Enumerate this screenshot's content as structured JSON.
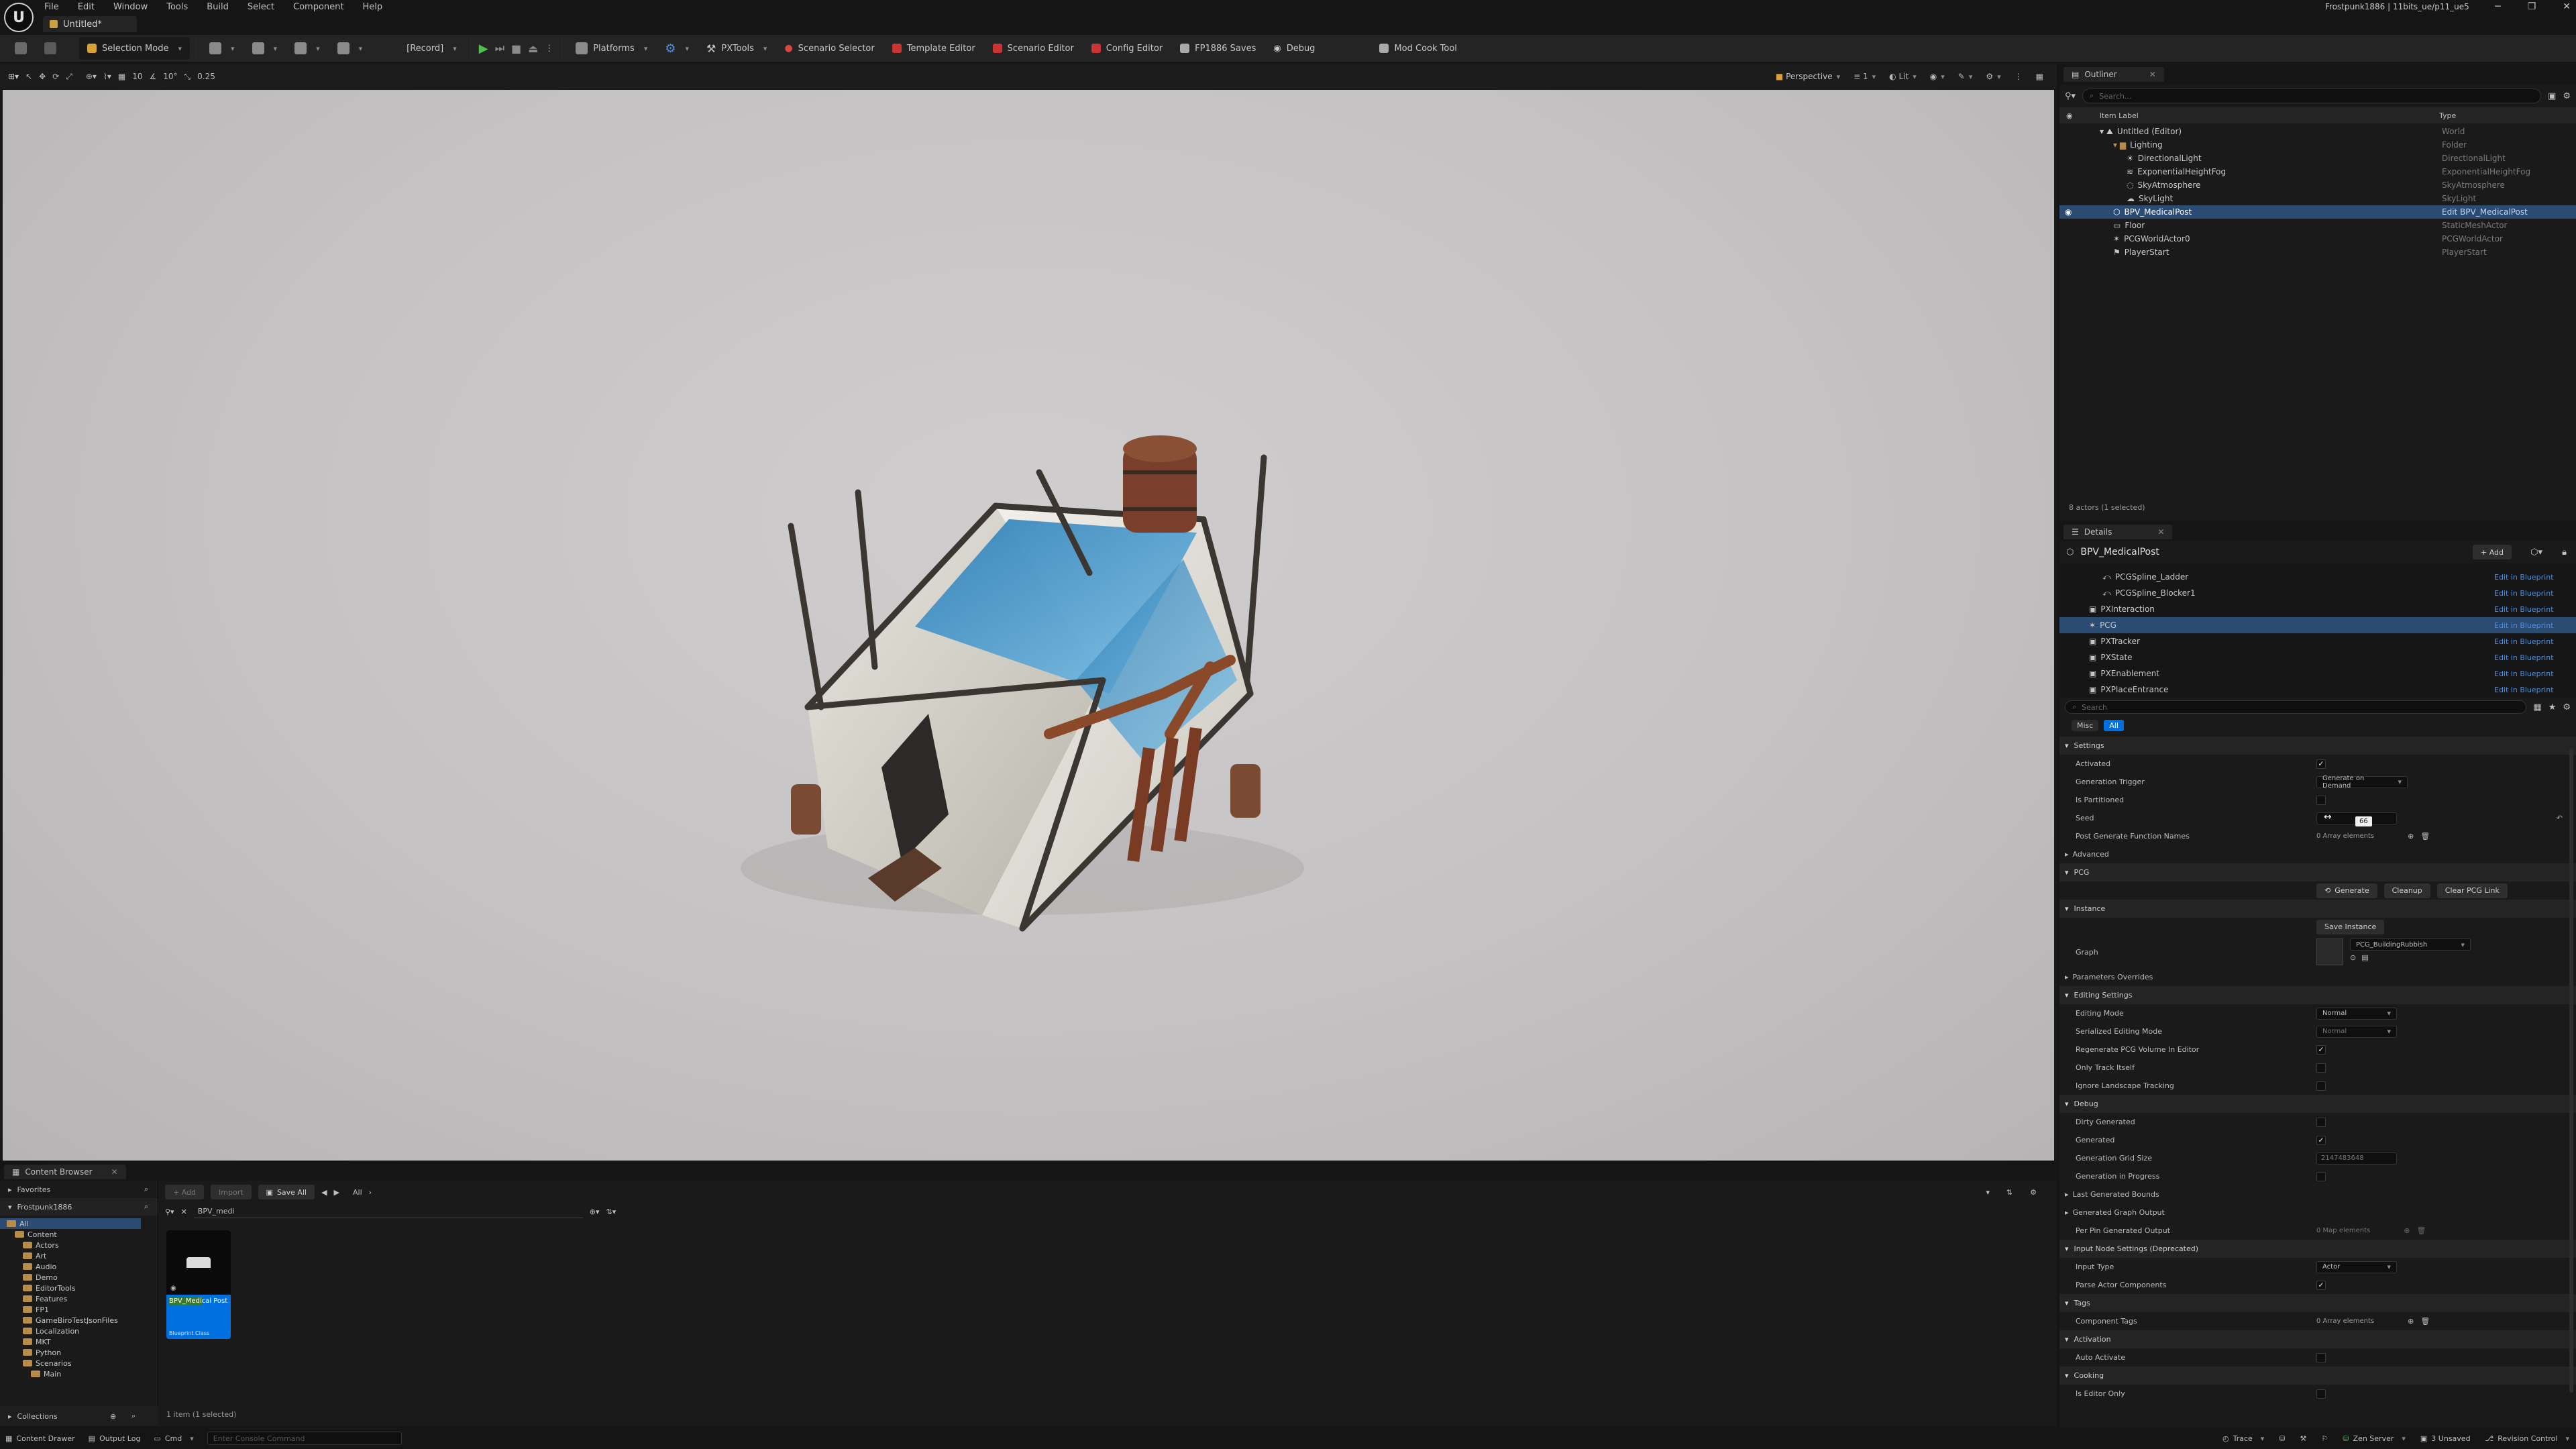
{
  "menubar": {
    "items": [
      "File",
      "Edit",
      "Window",
      "Tools",
      "Build",
      "Select",
      "Component",
      "Help"
    ],
    "project_title": "Frostpunk1886 | 11bits_ue/p11_ue5"
  },
  "tab": {
    "label": "Untitled*"
  },
  "toolbar": {
    "selection_mode": "Selection Mode",
    "record": "[Record]",
    "platforms": "Platforms",
    "pxtools": "PXTools",
    "scenario_selector": "Scenario Selector",
    "template_editor": "Template Editor",
    "scenario_editor": "Scenario Editor",
    "config_editor": "Config Editor",
    "fp1886_saves": "FP1886 Saves",
    "debug": "Debug",
    "mod_cook_tool": "Mod Cook Tool"
  },
  "viewport": {
    "perspective": "Perspective",
    "lit": "Lit",
    "snap_grid": "10",
    "snap_rotation": "10°",
    "snap_scale": "0.25",
    "camera_speed": "1"
  },
  "outliner": {
    "tab": "Outliner",
    "search_placeholder": "Search...",
    "col_label": "Item Label",
    "col_type": "Type",
    "rows": [
      {
        "label": "Untitled (Editor)",
        "type": "World"
      },
      {
        "label": "Lighting",
        "type": "Folder"
      },
      {
        "label": "DirectionalLight",
        "type": "DirectionalLight"
      },
      {
        "label": "ExponentialHeightFog",
        "type": "ExponentialHeightFog"
      },
      {
        "label": "SkyAtmosphere",
        "type": "SkyAtmosphere"
      },
      {
        "label": "SkyLight",
        "type": "SkyLight"
      },
      {
        "label": "BPV_MedicalPost",
        "type": "Edit BPV_MedicalPost"
      },
      {
        "label": "Floor",
        "type": "StaticMeshActor"
      },
      {
        "label": "PCGWorldActor0",
        "type": "PCGWorldActor"
      },
      {
        "label": "PlayerStart",
        "type": "PlayerStart"
      }
    ],
    "status": "8 actors (1 selected)"
  },
  "details": {
    "tab": "Details",
    "actor_name": "BPV_MedicalPost",
    "add_label": "+ Add",
    "components": [
      {
        "label": "PCGSpline_Ladder",
        "link": "Edit in Blueprint"
      },
      {
        "label": "PCGSpline_Blocker1",
        "link": "Edit in Blueprint"
      },
      {
        "label": "PXInteraction",
        "link": "Edit in Blueprint"
      },
      {
        "label": "PCG",
        "link": "Edit in Blueprint"
      },
      {
        "label": "PXTracker",
        "link": "Edit in Blueprint"
      },
      {
        "label": "PXState",
        "link": "Edit in Blueprint"
      },
      {
        "label": "PXEnablement",
        "link": "Edit in Blueprint"
      },
      {
        "label": "PXPlaceEntrance",
        "link": "Edit in Blueprint"
      }
    ],
    "search_placeholder": "Search",
    "filter_misc": "Misc",
    "filter_all": "All",
    "settings": {
      "header": "Settings",
      "activated": "Activated",
      "generation_trigger": "Generation Trigger",
      "generation_trigger_value": "Generate on Demand",
      "is_partitioned": "Is Partitioned",
      "seed": "Seed",
      "seed_value": "66",
      "post_generate": "Post Generate Function Names",
      "post_generate_value": "0 Array elements",
      "advanced": "Advanced"
    },
    "pcg": {
      "header": "PCG",
      "generate": "Generate",
      "cleanup": "Cleanup",
      "clear_link": "Clear PCG Link"
    },
    "instance": {
      "header": "Instance",
      "save_instance": "Save Instance",
      "graph": "Graph",
      "graph_value": "PCG_BuildingRubbish",
      "parameters_overrides": "Parameters Overrides"
    },
    "editing": {
      "header": "Editing Settings",
      "editing_mode": "Editing Mode",
      "editing_mode_value": "Normal",
      "serialized_mode": "Serialized Editing Mode",
      "serialized_mode_value": "Normal",
      "regenerate": "Regenerate PCG Volume In Editor",
      "track_itself": "Only Track Itself",
      "ignore_landscape": "Ignore Landscape Tracking"
    },
    "debug": {
      "header": "Debug",
      "dirty_generated": "Dirty Generated",
      "generated": "Generated",
      "grid_size": "Generation Grid Size",
      "grid_size_value": "2147483648",
      "in_progress": "Generation in Progress",
      "last_bounds": "Last Generated Bounds",
      "graph_output": "Generated Graph Output",
      "per_pin": "Per Pin Generated Output",
      "per_pin_value": "0 Map elements"
    },
    "input": {
      "header": "Input Node Settings (Deprecated)",
      "input_type": "Input Type",
      "input_type_value": "Actor",
      "parse_actor": "Parse Actor Components"
    },
    "tags": {
      "header": "Tags",
      "component_tags": "Component Tags",
      "component_tags_value": "0 Array elements"
    },
    "activation": {
      "header": "Activation",
      "auto_activate": "Auto Activate"
    },
    "cooking": {
      "header": "Cooking",
      "editor_only": "Is Editor Only"
    }
  },
  "content_browser": {
    "tab": "Content Browser",
    "add": "+ Add",
    "import": "Import",
    "save_all": "Save All",
    "path": "All",
    "favorites": "Favorites",
    "project": "Frostpunk1886",
    "tree": [
      "All",
      "Content",
      "Actors",
      "Art",
      "Audio",
      "Demo",
      "EditorTools",
      "Features",
      "FP1",
      "GameBiroTestJsonFiles",
      "Localization",
      "MKT",
      "Python",
      "Scenarios",
      "Main"
    ],
    "search_value": "BPV_medi",
    "asset_name_hl": "BPV_Medi",
    "asset_name_rest": "cal Post",
    "asset_class": "Blueprint Class",
    "status": "1 item (1 selected)",
    "collections": "Collections"
  },
  "statusbar": {
    "content_drawer": "Content Drawer",
    "output_log": "Output Log",
    "cmd": "Cmd",
    "console_placeholder": "Enter Console Command",
    "trace": "Trace",
    "zen_server": "Zen Server",
    "unsaved": "3 Unsaved",
    "revision_control": "Revision Control"
  },
  "colors": {
    "accent": "#0070e0",
    "selection": "#2b4b73",
    "highlight": "#3a7a2a",
    "link": "#4e8fe0"
  }
}
